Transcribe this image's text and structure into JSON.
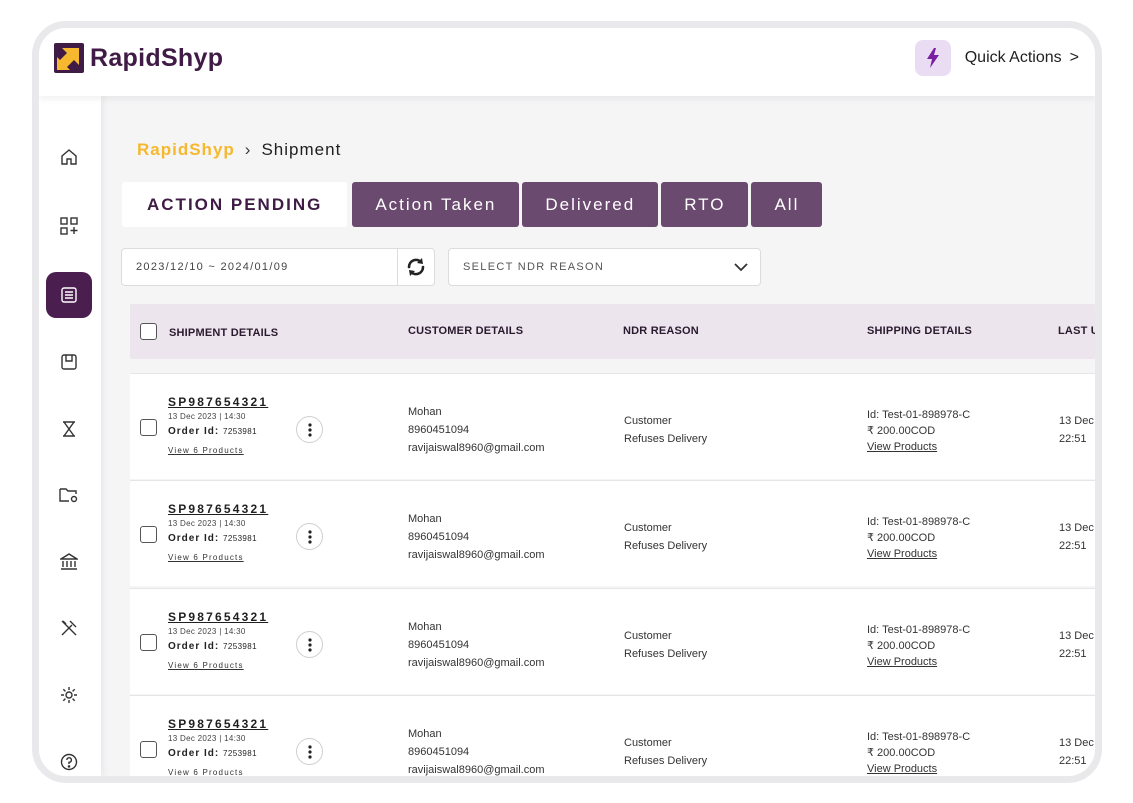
{
  "brand": {
    "name": "RapidShyp"
  },
  "header": {
    "quick_actions_label": "Quick Actions",
    "quick_actions_chevron": ">"
  },
  "sidebar": {
    "items": [
      {
        "name": "home-icon"
      },
      {
        "name": "apps-add-icon"
      },
      {
        "name": "list-icon",
        "active": true
      },
      {
        "name": "package-box-icon"
      },
      {
        "name": "hourglass-icon"
      },
      {
        "name": "folder-settings-icon"
      },
      {
        "name": "bank-icon"
      },
      {
        "name": "tools-icon"
      },
      {
        "name": "gear-icon"
      },
      {
        "name": "help-icon"
      }
    ]
  },
  "breadcrumb": {
    "root": "RapidShyp",
    "separator": "›",
    "current": "Shipment"
  },
  "tabs": [
    {
      "label": "ACTION PENDING",
      "active": true
    },
    {
      "label": "Action Taken"
    },
    {
      "label": "Delivered"
    },
    {
      "label": "RTO"
    },
    {
      "label": "All"
    }
  ],
  "filters": {
    "date_range": "2023/12/10 ~ 2024/01/09",
    "ndr_reason_placeholder": "SELECT NDR REASON"
  },
  "table": {
    "columns": [
      "SHIPMENT DETAILS",
      "CUSTOMER DETAILS",
      "NDR REASON",
      "SHIPPING DETAILS",
      "LAST UI"
    ],
    "rows": [
      {
        "shipment_id": "SP987654321",
        "date": "13 Dec 2023 | 14:30",
        "order_label": "Order Id:",
        "order_id": "7253981",
        "view_products_short": "View 6 Products",
        "customer_name": "Mohan",
        "phone": "8960451094",
        "email": "ravijaiswal8960@gmail.com",
        "ndr_line1": "Customer",
        "ndr_line2": "Refuses Delivery",
        "ship_id": "Id: Test-01-898978-C",
        "ship_amount": "₹ 200.00COD",
        "view_products": "View Products",
        "last_date": "13 Dec",
        "last_time": "22:51"
      },
      {
        "shipment_id": "SP987654321",
        "date": "13 Dec 2023 | 14:30",
        "order_label": "Order Id:",
        "order_id": "7253981",
        "view_products_short": "View 6 Products",
        "customer_name": "Mohan",
        "phone": "8960451094",
        "email": "ravijaiswal8960@gmail.com",
        "ndr_line1": "Customer",
        "ndr_line2": "Refuses Delivery",
        "ship_id": "Id: Test-01-898978-C",
        "ship_amount": "₹ 200.00COD",
        "view_products": "View Products",
        "last_date": "13 Dec",
        "last_time": "22:51"
      },
      {
        "shipment_id": "SP987654321",
        "date": "13 Dec 2023 | 14:30",
        "order_label": "Order Id:",
        "order_id": "7253981",
        "view_products_short": "View 6 Products",
        "customer_name": "Mohan",
        "phone": "8960451094",
        "email": "ravijaiswal8960@gmail.com",
        "ndr_line1": "Customer",
        "ndr_line2": "Refuses Delivery",
        "ship_id": "Id: Test-01-898978-C",
        "ship_amount": "₹ 200.00COD",
        "view_products": "View Products",
        "last_date": "13 Dec",
        "last_time": "22:51"
      },
      {
        "shipment_id": "SP987654321",
        "date": "13 Dec 2023 | 14:30",
        "order_label": "Order Id:",
        "order_id": "7253981",
        "view_products_short": "View 6 Products",
        "customer_name": "Mohan",
        "phone": "8960451094",
        "email": "ravijaiswal8960@gmail.com",
        "ndr_line1": "Customer",
        "ndr_line2": "Refuses Delivery",
        "ship_id": "Id: Test-01-898978-C",
        "ship_amount": "₹ 200.00COD",
        "view_products": "View Products",
        "last_date": "13 Dec",
        "last_time": "22:51"
      }
    ]
  },
  "colors": {
    "brand_purple": "#4a1f4f",
    "tab_purple": "#6b4a70",
    "accent_yellow": "#f5b82e",
    "header_row": "#ece5ee"
  }
}
